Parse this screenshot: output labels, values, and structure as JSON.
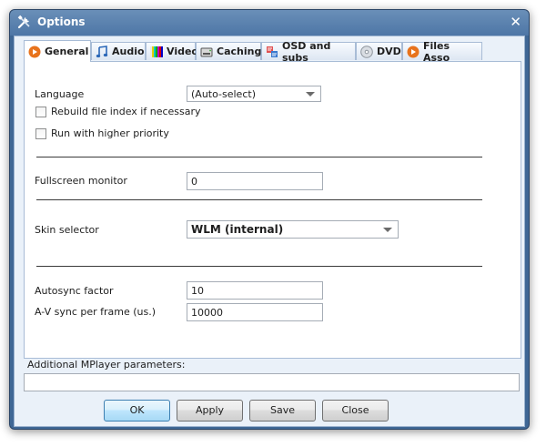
{
  "window": {
    "title": "Options",
    "close_label": "✕"
  },
  "tabs": [
    {
      "label": "General",
      "icon": "play-circle-icon"
    },
    {
      "label": "Audio",
      "icon": "music-note-icon"
    },
    {
      "label": "Video",
      "icon": "color-bars-icon"
    },
    {
      "label": "Caching",
      "icon": "hard-drive-icon"
    },
    {
      "label": "OSD and subs",
      "icon": "subtitles-icon"
    },
    {
      "label": "DVD",
      "icon": "dvd-disc-icon"
    },
    {
      "label": "Files Asso",
      "icon": "play-circle-icon"
    }
  ],
  "general": {
    "language_label": "Language",
    "language_value": "(Auto-select)",
    "rebuild_index_label": "Rebuild file index if necessary",
    "rebuild_index_checked": false,
    "higher_priority_label": "Run with higher priority",
    "higher_priority_checked": false,
    "fullscreen_monitor_label": "Fullscreen monitor",
    "fullscreen_monitor_value": "0",
    "skin_selector_label": "Skin selector",
    "skin_selector_value": "WLM (internal)",
    "autosync_label": "Autosync factor",
    "autosync_value": "10",
    "av_sync_label": "A-V sync per frame (us.)",
    "av_sync_value": "10000"
  },
  "params": {
    "label": "Additional MPlayer parameters:",
    "value": ""
  },
  "buttons": {
    "ok": "OK",
    "apply": "Apply",
    "save": "Save",
    "close": "Close"
  },
  "colors": {
    "titlebar": "#4e76a6",
    "client": "#eaf1f9",
    "accent_orange": "#e8731c"
  }
}
